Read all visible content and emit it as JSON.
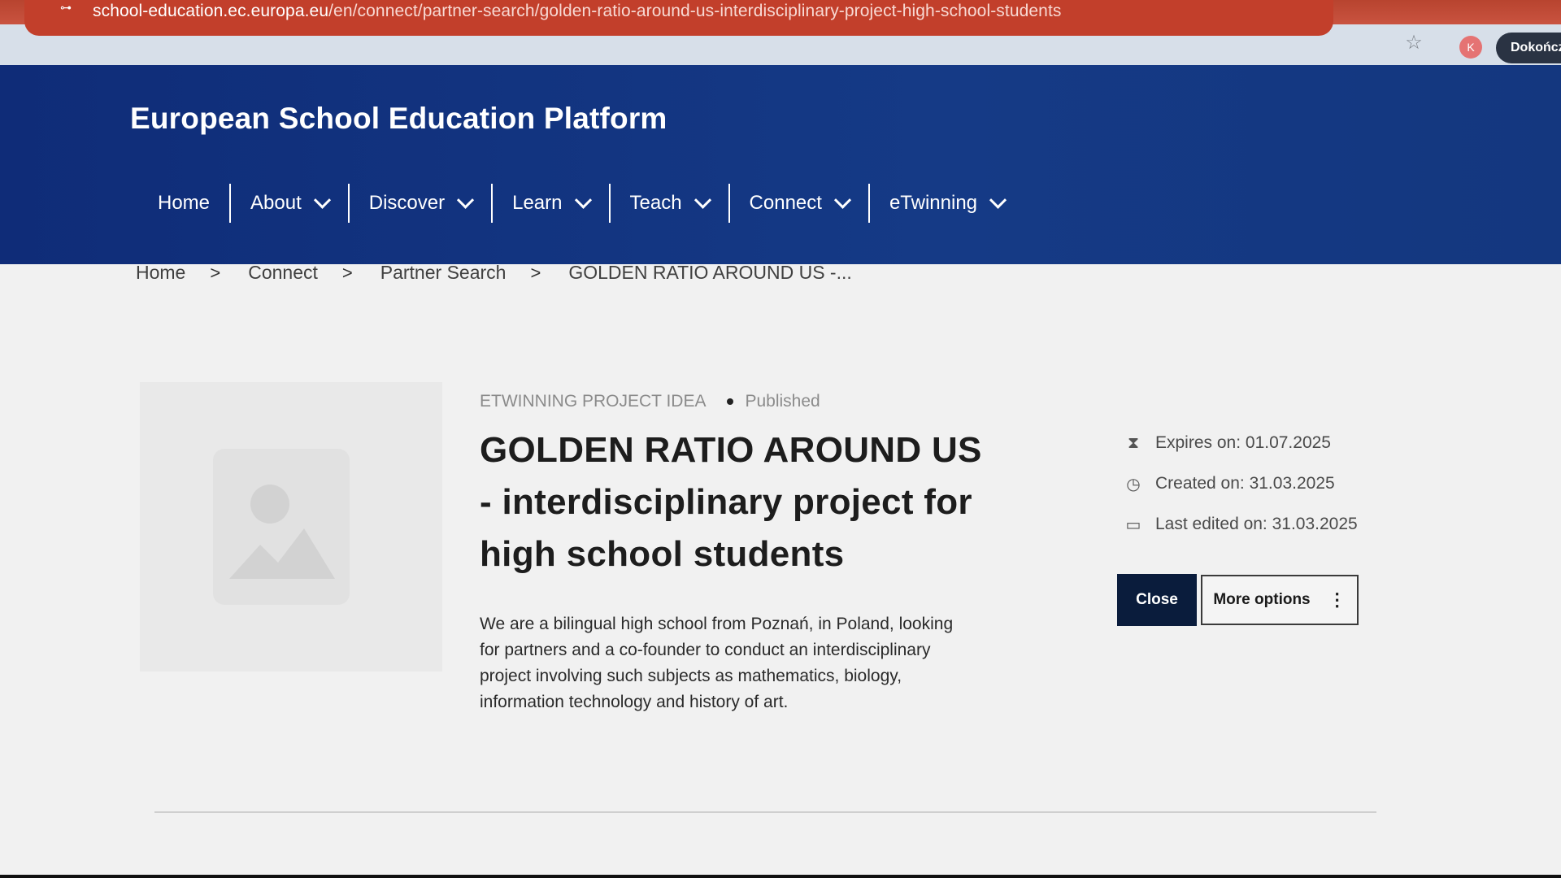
{
  "browser": {
    "url_host": "school-education.ec.europa.eu",
    "url_path": "/en/connect/partner-search/golden-ratio-around-us-interdisciplinary-project-high-school-students",
    "profile_initial": "K",
    "update_button": "Dokończ"
  },
  "site": {
    "title": "European School Education Platform"
  },
  "nav": {
    "items": [
      {
        "label": "Home",
        "has_dropdown": false
      },
      {
        "label": "About",
        "has_dropdown": true
      },
      {
        "label": "Discover",
        "has_dropdown": true
      },
      {
        "label": "Learn",
        "has_dropdown": true
      },
      {
        "label": "Teach",
        "has_dropdown": true
      },
      {
        "label": "Connect",
        "has_dropdown": true
      },
      {
        "label": "eTwinning",
        "has_dropdown": true
      }
    ]
  },
  "breadcrumb": {
    "items": [
      "Home",
      "Connect",
      "Partner Search",
      "GOLDEN RATIO AROUND US -..."
    ],
    "separator": ">"
  },
  "article": {
    "type_label": "ETWINNING PROJECT IDEA",
    "status": "Published",
    "title": "GOLDEN RATIO AROUND US - interdisciplinary project for high school students",
    "description": "We are a bilingual high school from Poznań, in Poland, looking for partners and a co-founder to conduct an interdisciplinary project involving such subjects as mathematics, biology, information technology and history of art."
  },
  "meta": {
    "expires": "Expires on: 01.07.2025",
    "created": "Created on: 31.03.2025",
    "edited": "Last edited on: 31.03.2025"
  },
  "actions": {
    "close_label": "Close",
    "more_label": "More options"
  },
  "icons": {
    "expires": "hourglass-icon",
    "created": "clock-icon",
    "edited": "calendar-icon",
    "more": "kebab-menu-icon"
  },
  "colors": {
    "header_blue": "#153a86",
    "button_dark": "#0a1c3c",
    "browser_red": "#c23f2b"
  }
}
